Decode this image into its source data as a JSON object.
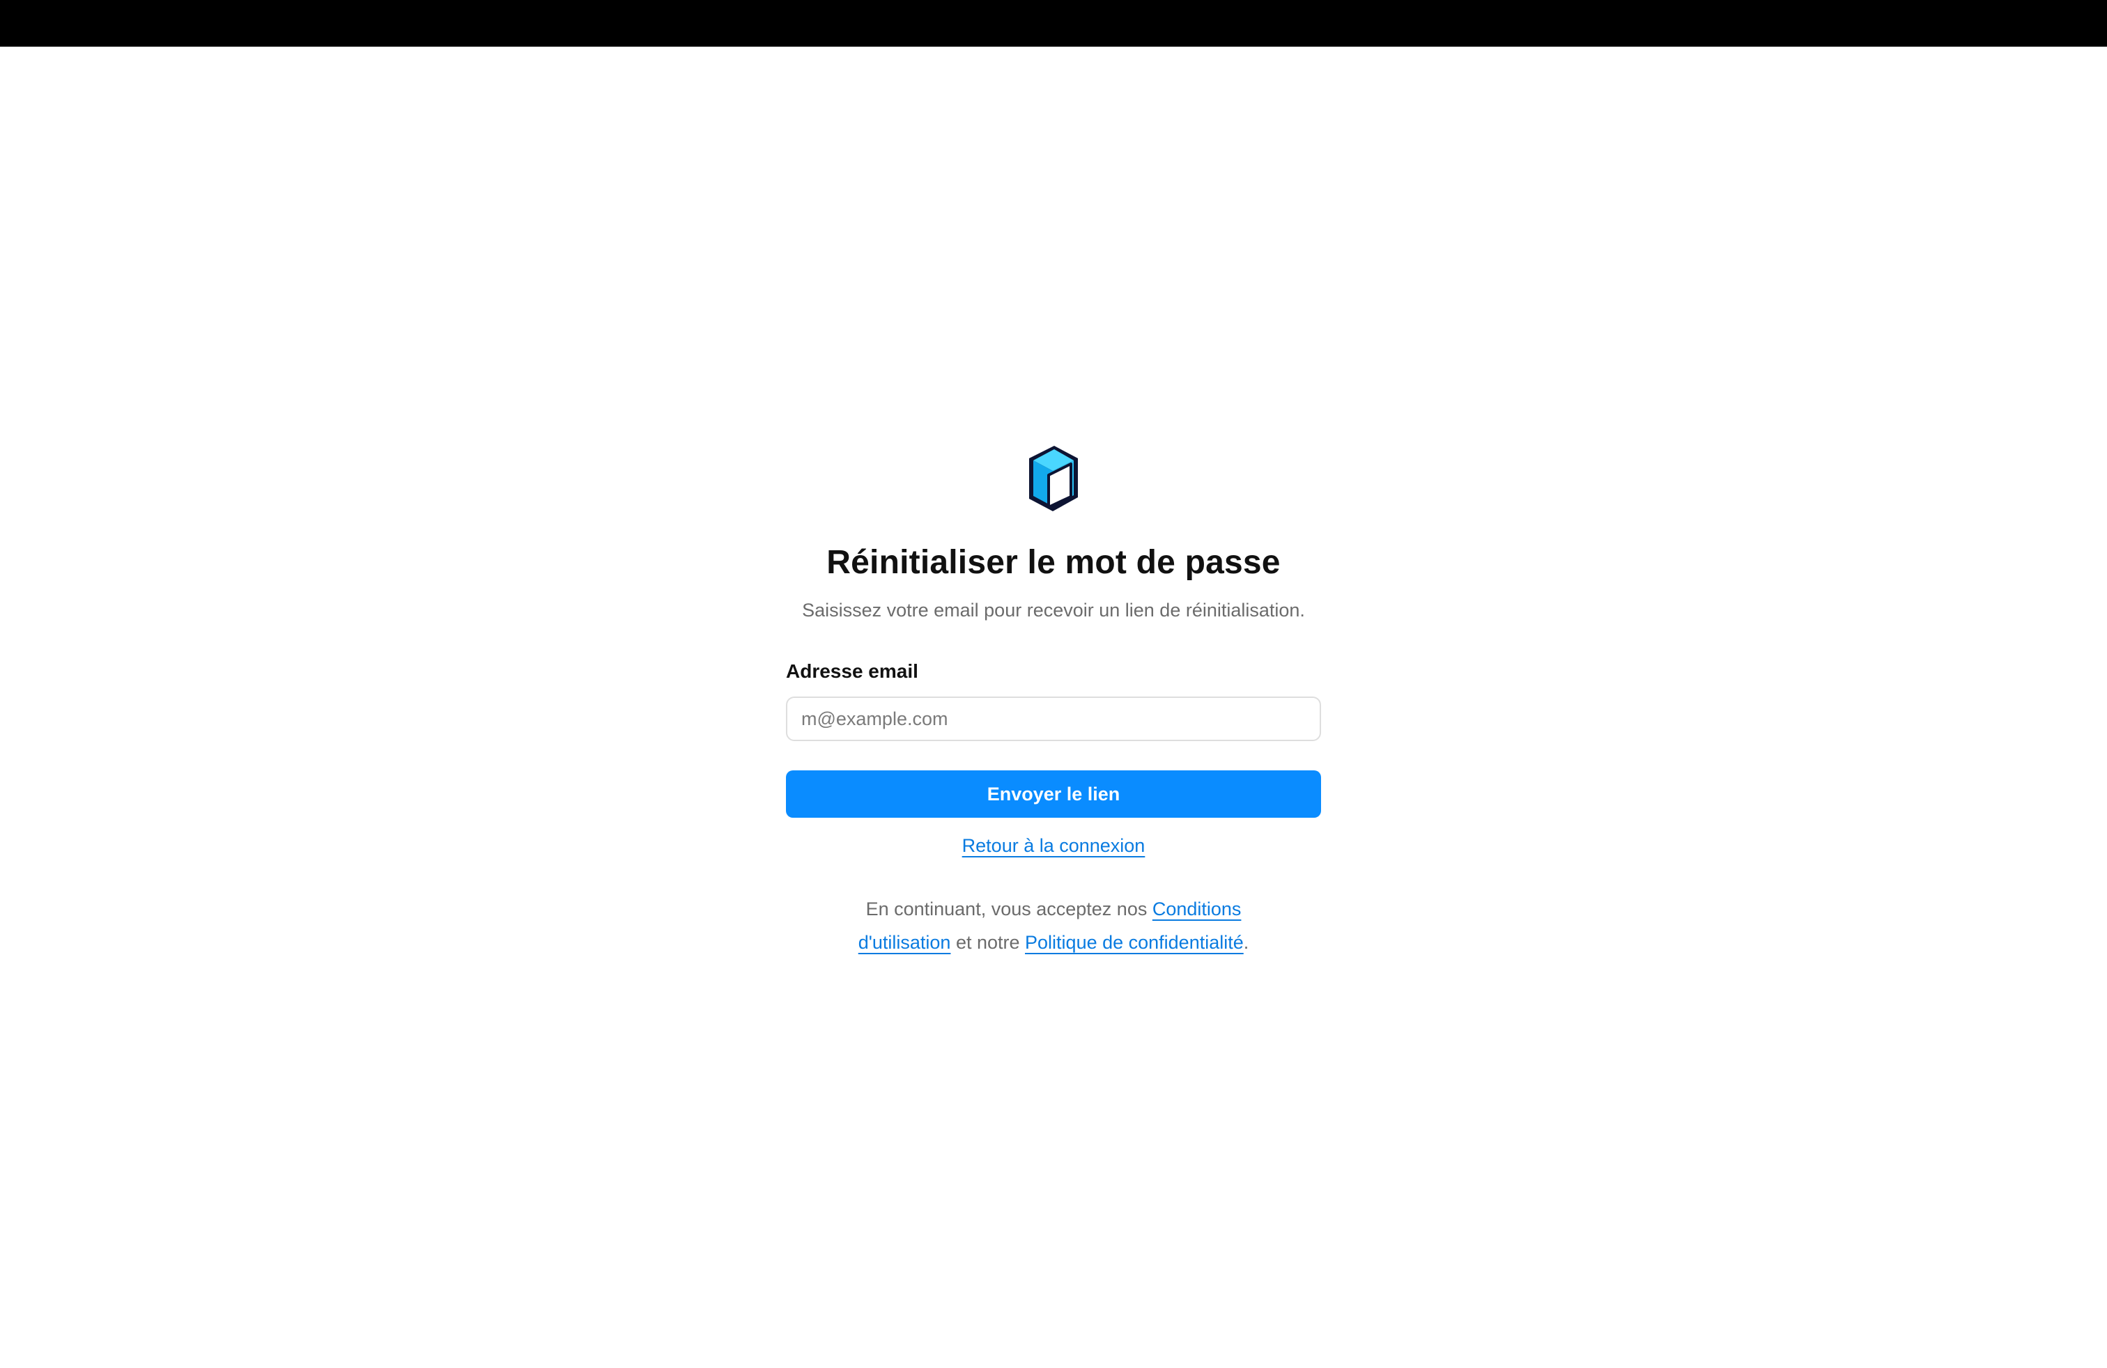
{
  "colors": {
    "accent": "#0a8cff",
    "link": "#0a7be0",
    "top_bar": "#000000",
    "logo_primary": "#1ab8f5",
    "logo_outline": "#0d1433"
  },
  "logo": {
    "icon": "cube-logo-icon"
  },
  "reset": {
    "title": "Réinitialiser le mot de passe",
    "subtitle": "Saisissez votre email pour recevoir un lien de réinitialisation.",
    "email_label": "Adresse email",
    "email_placeholder": "m@example.com",
    "email_value": "",
    "submit_label": "Envoyer le lien",
    "back_link": "Retour à la connexion"
  },
  "legal": {
    "prefix": "En continuant, vous acceptez nos ",
    "terms_link": "Conditions d'utilisation",
    "middle": " et notre ",
    "privacy_link": "Politique de confidentialité",
    "suffix": "."
  }
}
